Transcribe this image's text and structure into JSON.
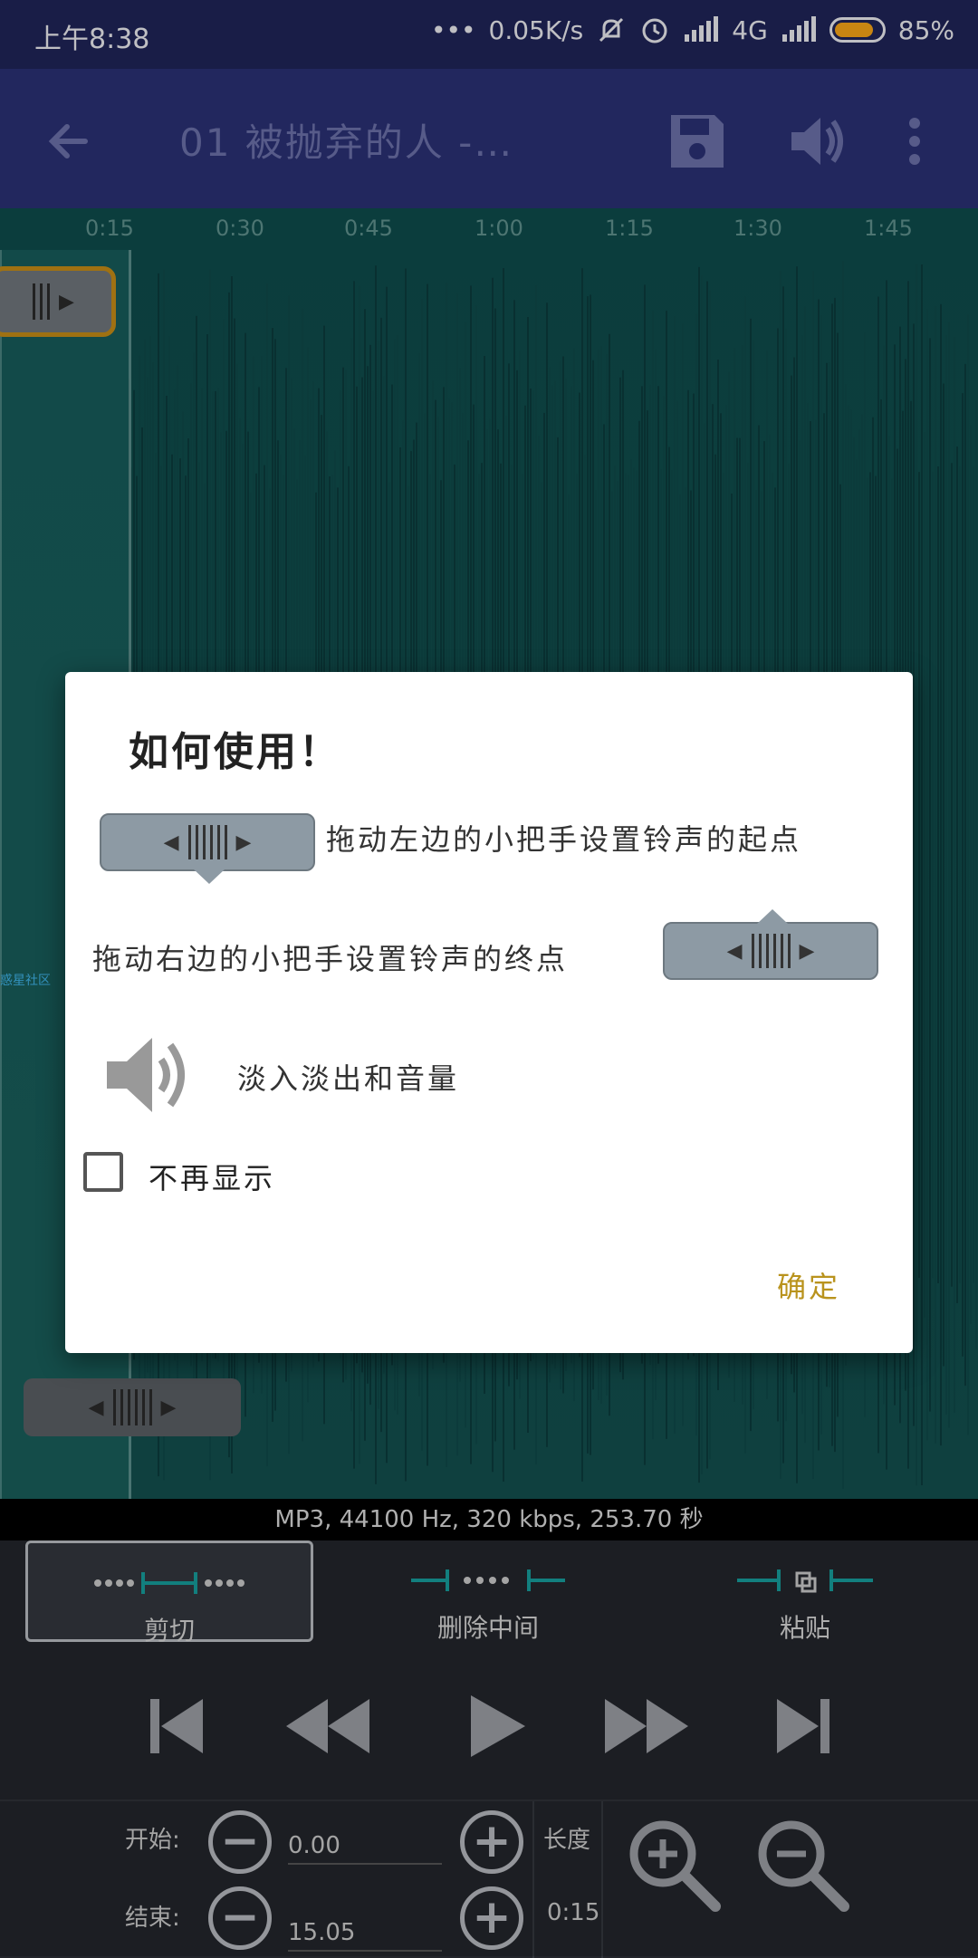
{
  "status_bar": {
    "time": "上午8:38",
    "network_speed": "0.05K/s",
    "network_type": "4G",
    "battery": "85%",
    "battery_level": 0.85
  },
  "toolbar": {
    "title": "01 被抛弃的人 -…"
  },
  "timeline": {
    "ticks": [
      "0:15",
      "0:30",
      "0:45",
      "1:00",
      "1:15",
      "1:30",
      "1:45"
    ]
  },
  "wave_overlay_text": "惑星社区",
  "info_bar": {
    "text": "MP3, 44100 Hz, 320 kbps, 253.70 秒"
  },
  "modes": {
    "cut": "剪切",
    "delete_middle": "删除中间",
    "paste": "粘贴"
  },
  "bottom": {
    "start_label": "开始:",
    "start_value": "0.00",
    "end_label": "结束:",
    "end_value": "15.05",
    "length_label": "长度",
    "length_value": "0:15"
  },
  "dialog": {
    "title": "如何使用！",
    "start_hint": "拖动左边的小把手设置铃声的起点",
    "end_hint": "拖动右边的小把手设置铃声的终点",
    "volume_hint": "淡入淡出和音量",
    "dont_show": "不再显示",
    "ok": "确定"
  },
  "colors": {
    "status_bg": "#1f2457",
    "toolbar_bg": "#2a3073",
    "wave_bg": "#0e4b4b",
    "accent_handle": "#c28a16",
    "ok_color": "#b9931d",
    "mode_teal": "#169c9a"
  }
}
